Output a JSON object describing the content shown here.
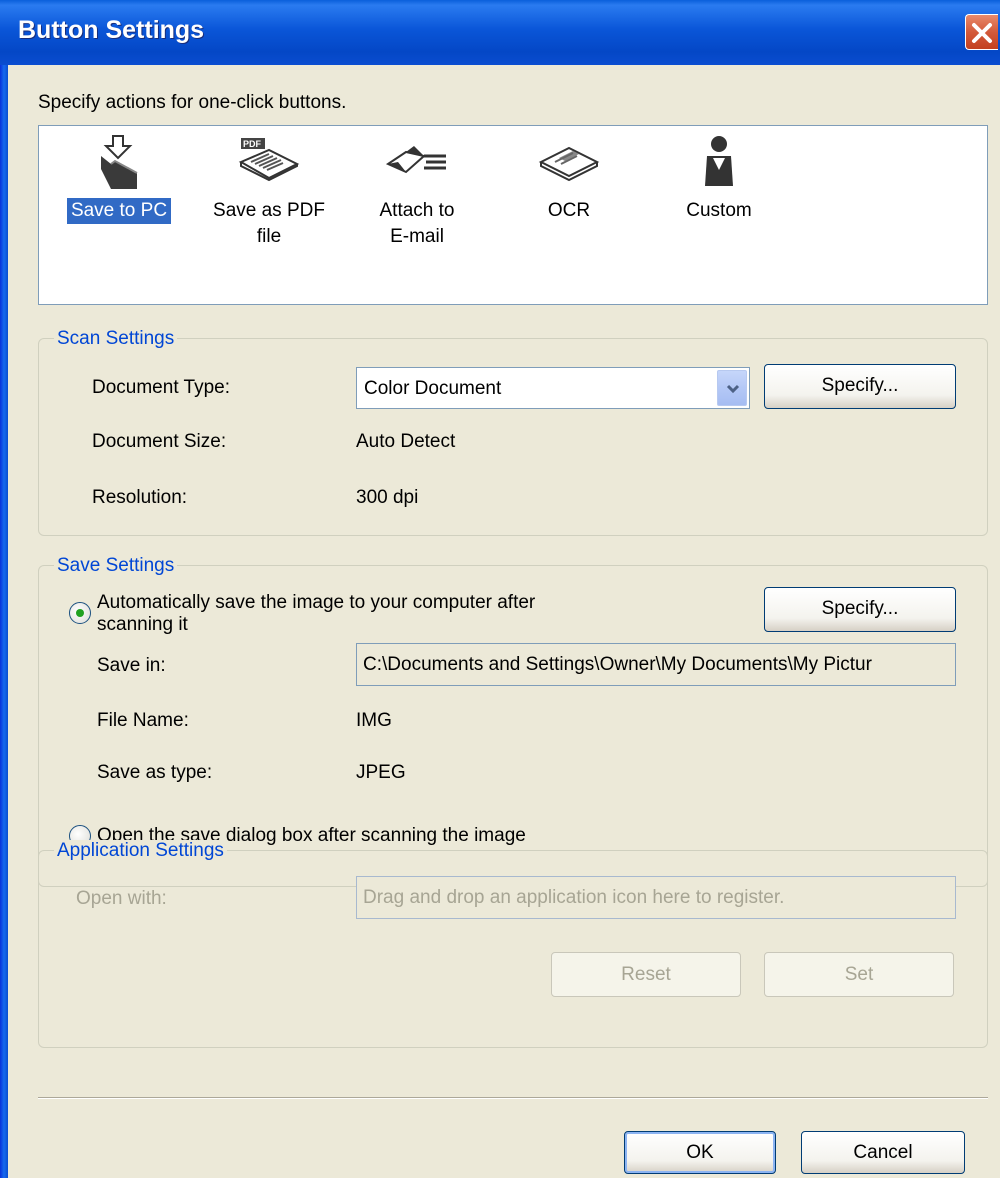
{
  "window": {
    "title": "Button Settings"
  },
  "intro": "Specify actions for one-click buttons.",
  "actions": [
    {
      "label1": "Save to PC",
      "label2": ""
    },
    {
      "label1": "Save as PDF",
      "label2": "file"
    },
    {
      "label1": "Attach to",
      "label2": "E-mail"
    },
    {
      "label1": "OCR",
      "label2": ""
    },
    {
      "label1": "Custom",
      "label2": ""
    }
  ],
  "scan_settings": {
    "legend": "Scan Settings",
    "document_type_label": "Document Type:",
    "document_type_value": "Color Document",
    "specify_label": "Specify...",
    "document_size_label": "Document Size:",
    "document_size_value": "Auto Detect",
    "resolution_label": "Resolution:",
    "resolution_value": "300 dpi"
  },
  "save_settings": {
    "legend": "Save Settings",
    "auto_save_line1": "Automatically save the image to your computer after",
    "auto_save_line2": "scanning it",
    "specify_label": "Specify...",
    "save_in_label": "Save in:",
    "save_in_value": "C:\\Documents and Settings\\Owner\\My Documents\\My Pictur",
    "file_name_label": "File Name:",
    "file_name_value": "IMG",
    "save_type_label": "Save as type:",
    "save_type_value": "JPEG",
    "open_dialog_label": "Open the save dialog box after scanning the image"
  },
  "app_settings": {
    "legend": "Application Settings",
    "open_with_label": "Open with:",
    "drop_hint": "Drag and drop an application icon here to register.",
    "reset_label": "Reset",
    "set_label": "Set"
  },
  "footer": {
    "ok_label": "OK",
    "cancel_label": "Cancel"
  },
  "colors": {
    "selection": "#316ac5",
    "legend": "#0046d5",
    "dialog_bg": "#ece9d8",
    "titlebar": "#0a56d8"
  },
  "icons": [
    "close-icon",
    "save-to-pc-icon",
    "pdf-icon",
    "email-icon",
    "ocr-icon",
    "custom-person-icon",
    "chevron-down-icon"
  ]
}
